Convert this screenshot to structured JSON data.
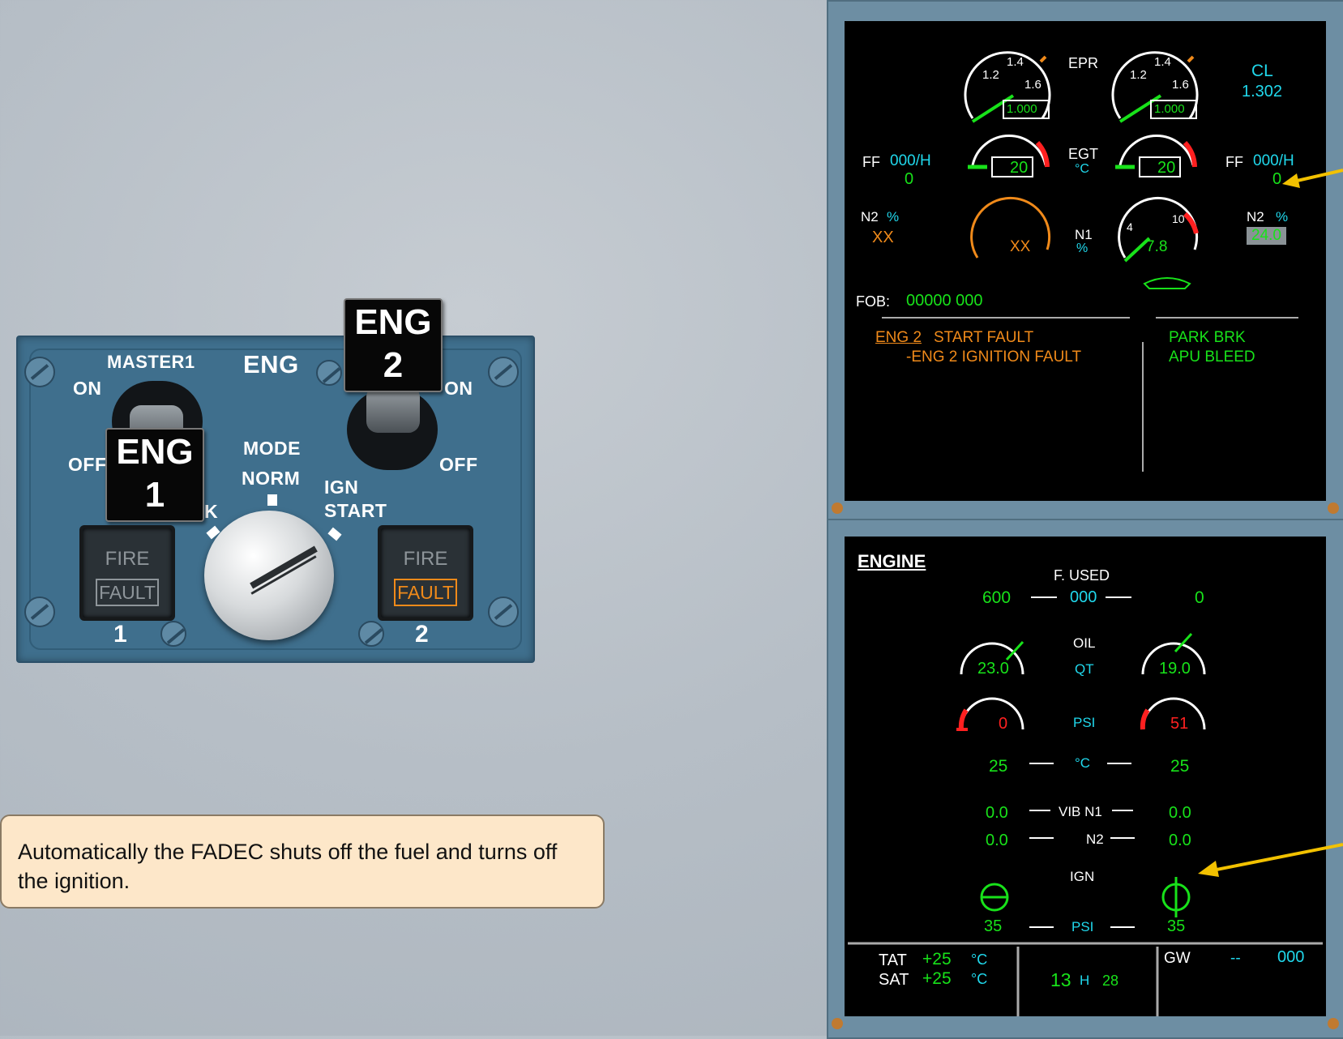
{
  "overhead_panel": {
    "master1_label": "MASTER1",
    "eng_label": "ENG",
    "sw1_on": "ON",
    "sw1_off": "OFF",
    "sw2_on": "ON",
    "sw2_off": "OFF",
    "placard1_top": "ENG",
    "placard1_num": "1",
    "placard2_top": "ENG",
    "placard2_num": "2",
    "mode_label": "MODE",
    "norm_label": "NORM",
    "ign_label": "IGN",
    "start_label": "START",
    "crank_partial": "K",
    "fire1": {
      "fire": "FIRE",
      "fault": "FAULT",
      "number": "1"
    },
    "fire2": {
      "fire": "FIRE",
      "fault": "FAULT",
      "number": "2",
      "fault_lit": true
    }
  },
  "callout_text": "Automatically the FADEC shuts off the fuel and turns off the ignition.",
  "ewd": {
    "epr_label": "EPR",
    "epr_scale": [
      "1.2",
      "1.4",
      "1.6"
    ],
    "epr1_box": "1.000",
    "epr2_box": "1.000",
    "thrust_mode": "CL",
    "thrust_value": "1.302",
    "egt_label": "EGT",
    "egt_unit": "°C",
    "egt1": "20",
    "egt2": "20",
    "ff_label": "FF",
    "ff_unit": "000/H",
    "ff1": "0",
    "ff2": "0",
    "n2_label": "N2",
    "n2_unit": "%",
    "n2_1": "XX",
    "n2_2": "24.0",
    "n1_label": "N1",
    "n1_unit": "%",
    "n1_1": "XX",
    "n1_2": "7.8",
    "n1_scale": [
      "4",
      "10"
    ],
    "fob_label": "FOB:",
    "fob_value": "00000 000",
    "warn_line1_a": "ENG 2",
    "warn_line1_b": "START FAULT",
    "warn_line2": "-ENG 2  IGNITION FAULT",
    "memo1": "PARK BRK",
    "memo2": "APU BLEED"
  },
  "sd": {
    "title": "ENGINE",
    "fused_label": "F. USED",
    "fused_unit": "000",
    "fused1": "600",
    "fused2": "0",
    "oil_label": "OIL",
    "qt_label": "QT",
    "oil_qt1": "23.0",
    "oil_qt2": "19.0",
    "psi_label": "PSI",
    "oil_psi1": "0",
    "oil_psi2": "51",
    "temp_unit": "°C",
    "oil_temp1": "25",
    "oil_temp2": "25",
    "vib_n1_label": "VIB N1",
    "vib_n2_label": "N2",
    "vib_n1_1": "0.0",
    "vib_n1_2": "0.0",
    "vib_n2_1": "0.0",
    "vib_n2_2": "0.0",
    "ign_label": "IGN",
    "bleed_psi_label": "PSI",
    "bleed_psi1": "35",
    "bleed_psi2": "35",
    "tat_label": "TAT",
    "tat_value": "+25",
    "sat_label": "SAT",
    "sat_value": "+25",
    "deg_unit": "°C",
    "time_h": "13",
    "time_h_label": "H",
    "time_m": "28",
    "gw_label": "GW",
    "gw_dash": "--",
    "gw_unit": "000"
  },
  "colors": {
    "green": "#18e21a",
    "cyan": "#20d8ec",
    "amber": "#f08a1a",
    "red": "#ff2020",
    "arrow": "#f2c100"
  }
}
